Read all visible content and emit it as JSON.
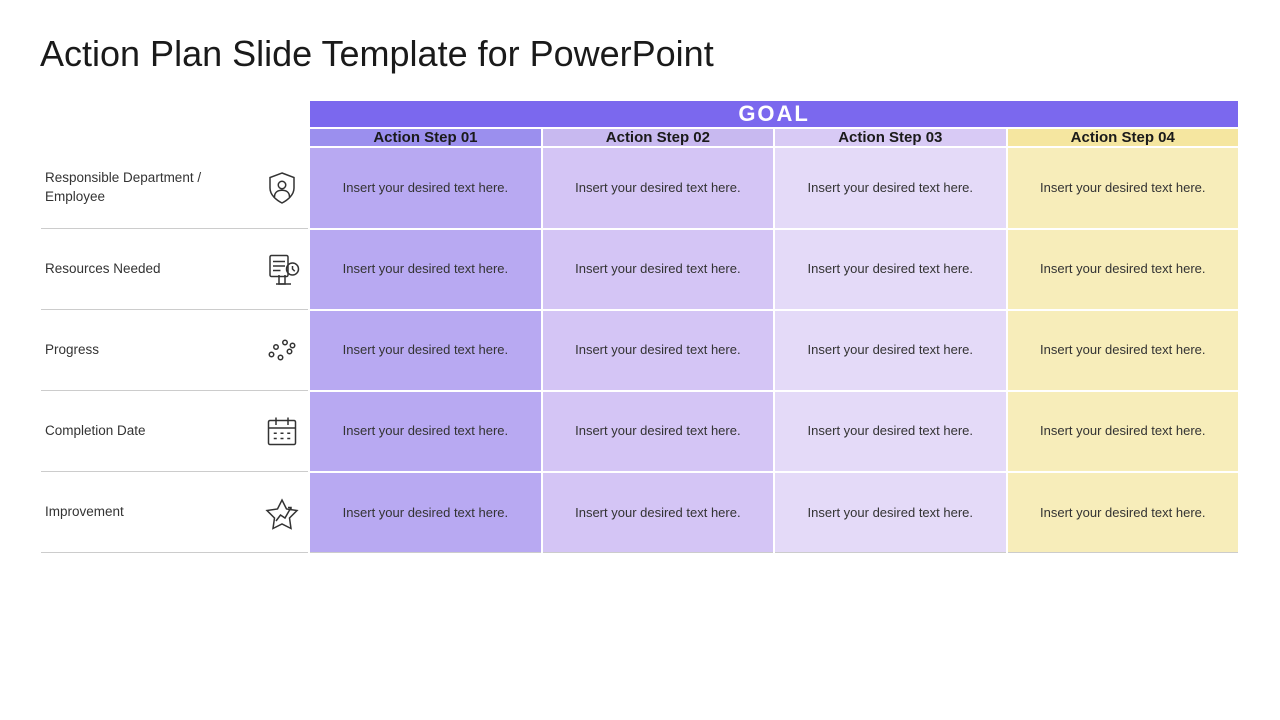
{
  "title": "Action Plan Slide Template for PowerPoint",
  "goal_label": "GOAL",
  "steps": [
    {
      "label": "Action Step 01"
    },
    {
      "label": "Action Step 02"
    },
    {
      "label": "Action Step 03"
    },
    {
      "label": "Action Step 04"
    }
  ],
  "rows": [
    {
      "label": "Responsible Department / Employee",
      "icon": "shield-person-icon",
      "cells": [
        "Insert your desired text here.",
        "Insert your desired text here.",
        "Insert your desired text here.",
        "Insert your desired text here."
      ]
    },
    {
      "label": "Resources Needed",
      "icon": "resources-icon",
      "cells": [
        "Insert your desired text here.",
        "Insert your desired text here.",
        "Insert your desired text here.",
        "Insert your desired text here."
      ]
    },
    {
      "label": "Progress",
      "icon": "progress-icon",
      "cells": [
        "Insert your desired text here.",
        "Insert your desired text here.",
        "Insert your desired text here.",
        "Insert your desired text here."
      ]
    },
    {
      "label": "Completion Date",
      "icon": "calendar-icon",
      "cells": [
        "Insert your desired text here.",
        "Insert your desired text here.",
        "Insert your desired text here.",
        "Insert your desired text here."
      ]
    },
    {
      "label": "Improvement",
      "icon": "improvement-icon",
      "cells": [
        "Insert your desired text here.",
        "Insert your desired text here.",
        "Insert your desired text here.",
        "Insert your desired text here."
      ]
    }
  ],
  "colors": {
    "goal_bg": "#7B68EE",
    "step01_bg": "#9B8FEE",
    "step02_bg": "#C8B9F0",
    "step03_bg": "#D8CAF5",
    "step04_bg": "#F5E6A0",
    "cell01_bg": "#B8A9F2",
    "cell02_bg": "#D4C5F5",
    "cell03_bg": "#E4DAF8",
    "cell04_bg": "#F7EDBA"
  }
}
